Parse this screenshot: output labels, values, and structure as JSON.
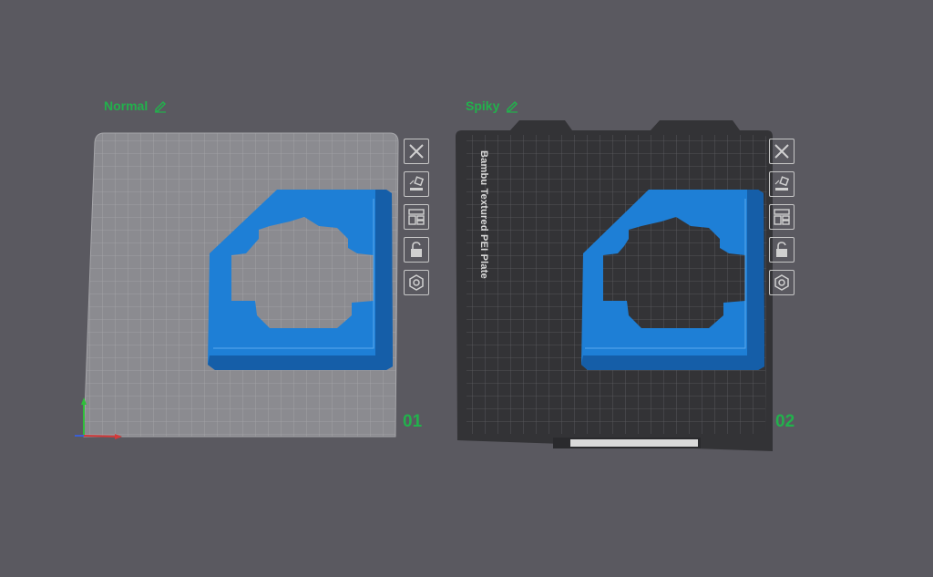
{
  "plates": [
    {
      "name": "Normal",
      "number": "01"
    },
    {
      "name": "Spiky",
      "number": "02",
      "plate_label": "Bambu Textured PEI Plate"
    }
  ],
  "toolbar_icons": [
    "close-icon",
    "auto-orient-icon",
    "arrange-icon",
    "lock-icon",
    "settings-icon"
  ],
  "colors": {
    "background": "#5a5960",
    "accent_green": "#22b14c",
    "model_blue": "#1f7fd6",
    "plate_light": "#8c8c90",
    "plate_dark": "#333336"
  }
}
